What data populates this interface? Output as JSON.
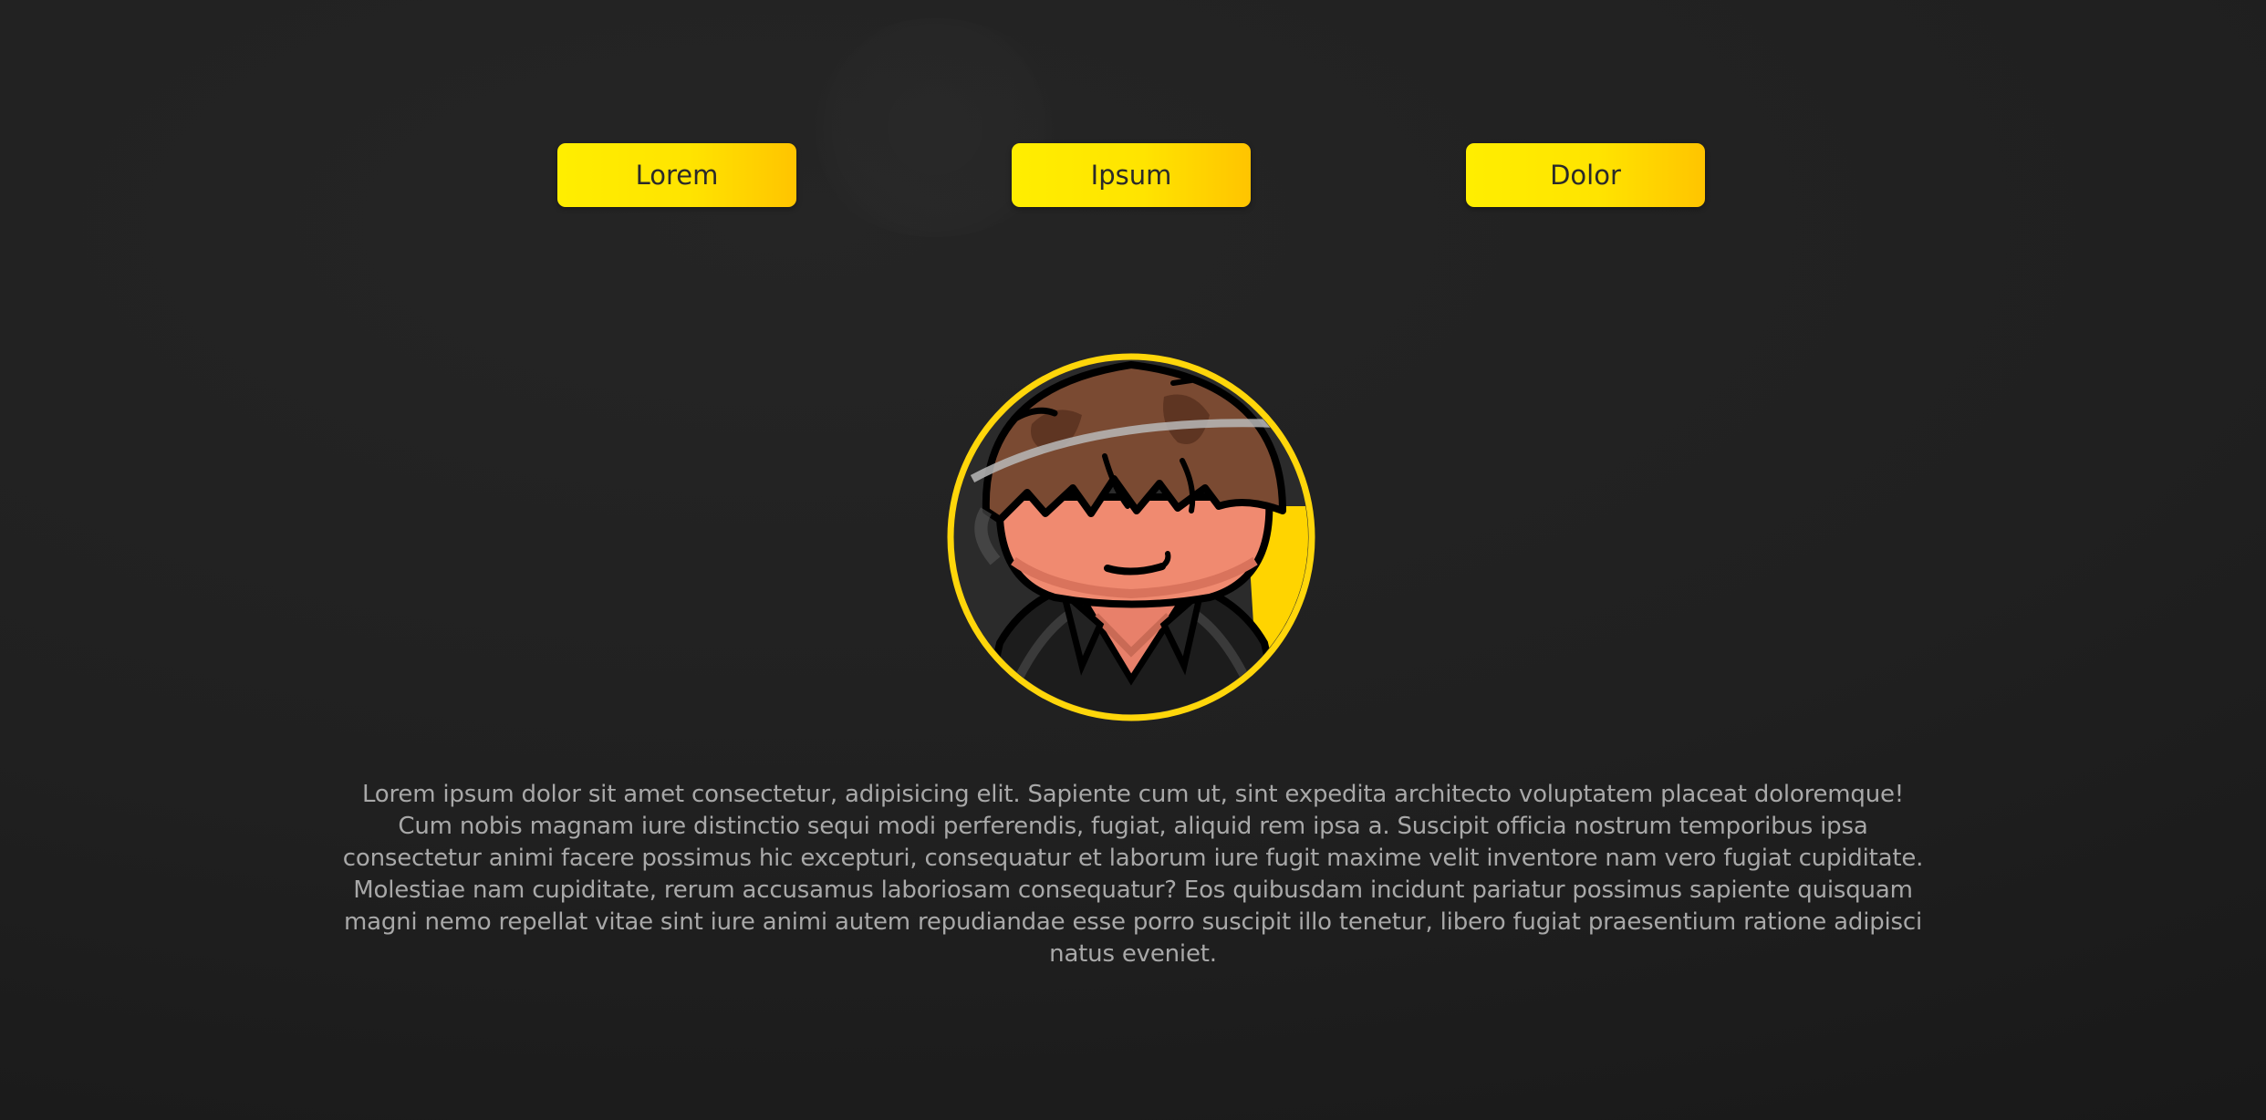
{
  "nav": {
    "buttons": [
      {
        "label": "Lorem"
      },
      {
        "label": "Ipsum"
      },
      {
        "label": "Dolor"
      }
    ]
  },
  "profile": {
    "avatar_icon": "cartoon-avatar-icon",
    "ring_color": "#ffd60a"
  },
  "content": {
    "description": "Lorem ipsum dolor sit amet consectetur, adipisicing elit. Sapiente cum ut, sint expedita architecto voluptatem placeat doloremque! Cum nobis magnam iure distinctio sequi modi perferendis, fugiat, aliquid rem ipsa a. Suscipit officia nostrum temporibus ipsa consectetur animi facere possimus hic excepturi, consequatur et laborum iure fugit maxime velit inventore nam vero fugiat cupiditate. Molestiae nam cupiditate, rerum accusamus laboriosam consequatur? Eos quibusdam incidunt pariatur possimus sapiente quisquam magni nemo repellat vitae sint iure animi autem repudiandae esse porro suscipit illo tenetur, libero fugiat praesentium ratione adipisci natus eveniet."
  },
  "theme": {
    "accent": "#ffe600",
    "background": "#1f1f1f",
    "text": "#a8a8a8"
  }
}
